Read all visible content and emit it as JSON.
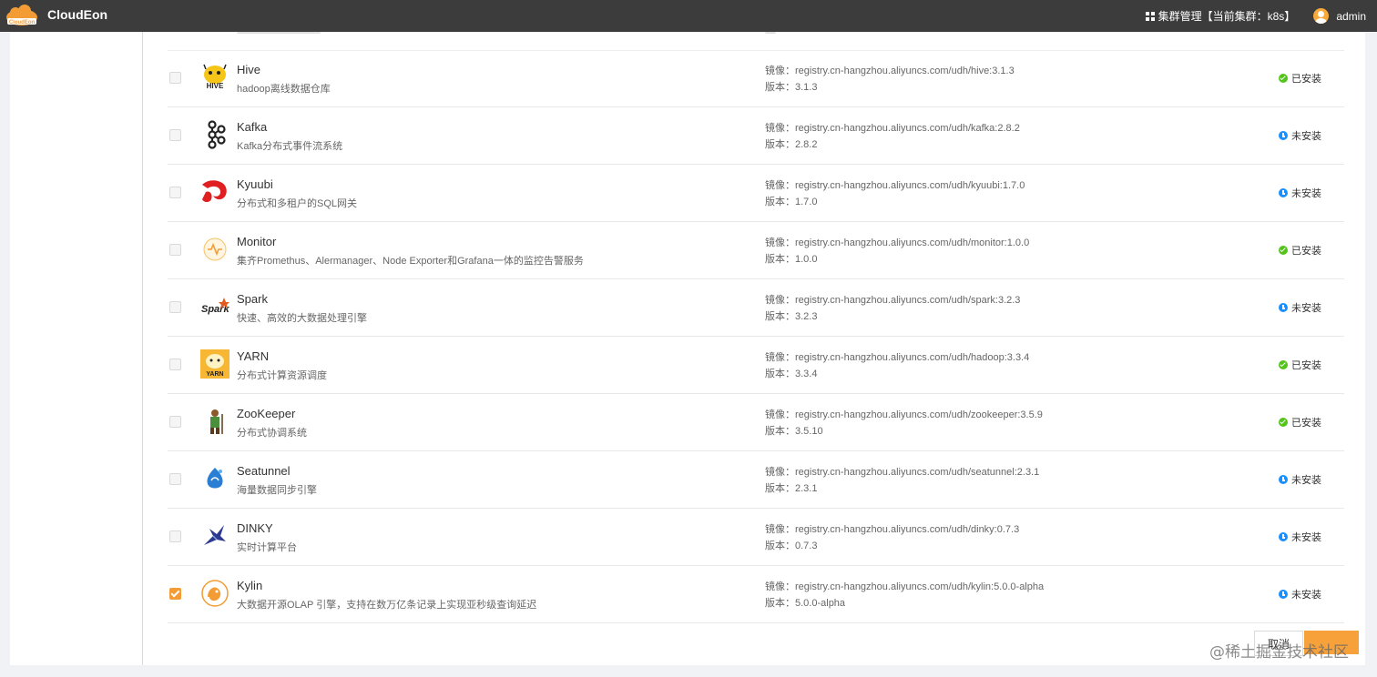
{
  "app": {
    "title": "CloudEon",
    "logo_text": "CloudEon"
  },
  "header": {
    "cluster_link": "集群管理【当前集群：k8s】",
    "user": "admin"
  },
  "services": [
    {
      "name": "Hive",
      "desc": "hadoop离线数据仓库",
      "image": "镜像：registry.cn-hangzhou.aliyuncs.com/udh/hive:3.1.3",
      "version": "版本：3.1.3",
      "status": "已安装",
      "state": "installed",
      "checked": false,
      "icon": "hive-icon"
    },
    {
      "name": "Kafka",
      "desc": "Kafka分布式事件流系统",
      "image": "镜像：registry.cn-hangzhou.aliyuncs.com/udh/kafka:2.8.2",
      "version": "版本：2.8.2",
      "status": "未安装",
      "state": "pending",
      "checked": false,
      "icon": "kafka-icon"
    },
    {
      "name": "Kyuubi",
      "desc": "分布式和多租户的SQL网关",
      "image": "镜像：registry.cn-hangzhou.aliyuncs.com/udh/kyuubi:1.7.0",
      "version": "版本：1.7.0",
      "status": "未安装",
      "state": "pending",
      "checked": false,
      "icon": "kyuubi-icon"
    },
    {
      "name": "Monitor",
      "desc": "集齐Promethus、Alermanager、Node Exporter和Grafana一体的监控告警服务",
      "image": "镜像：registry.cn-hangzhou.aliyuncs.com/udh/monitor:1.0.0",
      "version": "版本：1.0.0",
      "status": "已安装",
      "state": "installed",
      "checked": false,
      "icon": "monitor-icon"
    },
    {
      "name": "Spark",
      "desc": "快速、高效的大数据处理引擎",
      "image": "镜像：registry.cn-hangzhou.aliyuncs.com/udh/spark:3.2.3",
      "version": "版本：3.2.3",
      "status": "未安装",
      "state": "pending",
      "checked": false,
      "icon": "spark-icon"
    },
    {
      "name": "YARN",
      "desc": "分布式计算资源调度",
      "image": "镜像：registry.cn-hangzhou.aliyuncs.com/udh/hadoop:3.3.4",
      "version": "版本：3.3.4",
      "status": "已安装",
      "state": "installed",
      "checked": false,
      "icon": "yarn-icon"
    },
    {
      "name": "ZooKeeper",
      "desc": "分布式协调系统",
      "image": "镜像：registry.cn-hangzhou.aliyuncs.com/udh/zookeeper:3.5.9",
      "version": "版本：3.5.10",
      "status": "已安装",
      "state": "installed",
      "checked": false,
      "icon": "zookeeper-icon"
    },
    {
      "name": "Seatunnel",
      "desc": "海量数据同步引擎",
      "image": "镜像：registry.cn-hangzhou.aliyuncs.com/udh/seatunnel:2.3.1",
      "version": "版本：2.3.1",
      "status": "未安装",
      "state": "pending",
      "checked": false,
      "icon": "seatunnel-icon"
    },
    {
      "name": "DINKY",
      "desc": "实时计算平台",
      "image": "镜像：registry.cn-hangzhou.aliyuncs.com/udh/dinky:0.7.3",
      "version": "版本：0.7.3",
      "status": "未安装",
      "state": "pending",
      "checked": false,
      "icon": "dinky-icon"
    },
    {
      "name": "Kylin",
      "desc": "大数据开源OLAP 引擎，支持在数万亿条记录上实现亚秒级查询延迟",
      "image": "镜像：registry.cn-hangzhou.aliyuncs.com/udh/kylin:5.0.0-alpha",
      "version": "版本：5.0.0-alpha",
      "status": "未安装",
      "state": "pending",
      "checked": true,
      "icon": "kylin-icon"
    }
  ],
  "footer": {
    "cancel_label": "取消",
    "watermark": "@稀土掘金技术社区"
  },
  "colors": {
    "header_bg": "#3c3c3c",
    "accent": "#f7a13b",
    "installed": "#52c41a",
    "pending": "#1890ff"
  }
}
